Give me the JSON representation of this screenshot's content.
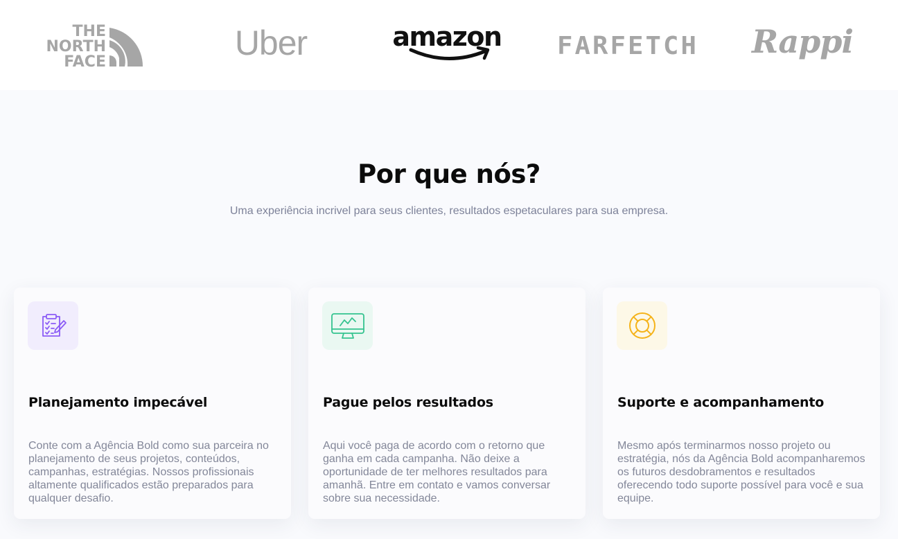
{
  "logos": [
    {
      "name": "The North Face",
      "lines": [
        "THE",
        "NORTH",
        "FACE"
      ],
      "color": "#a6a6a6"
    },
    {
      "name": "Uber",
      "text": "Uber",
      "color": "#a6a6a6"
    },
    {
      "name": "Amazon",
      "text": "amazon",
      "color": "#111111"
    },
    {
      "name": "Farfetch",
      "text": "FARFETCH",
      "color": "#a6a6a6"
    },
    {
      "name": "Rappi",
      "text": "Rappi",
      "color": "#a6a6a6"
    }
  ],
  "section": {
    "title": "Por que nós?",
    "subtitle": "Uma experiência incrivel para seus clientes, resultados espetaculares para sua empresa."
  },
  "cards": [
    {
      "icon": "clipboard-checklist-icon",
      "icon_color": "#8b5cf6",
      "icon_bg": "#f1edfd",
      "title": "Planejamento impecável",
      "text": "Conte com a Agência Bold como sua parceira no planejamento de seus projetos, conteúdos, campanhas, estratégias. Nossos profissionais altamente qualificados estão preparados para qualquer desafio."
    },
    {
      "icon": "monitor-chart-icon",
      "icon_color": "#34c38f",
      "icon_bg": "#eaf8f2",
      "title": "Pague pelos resultados",
      "text": "Aqui você paga de acordo com o retorno que ganha em cada campanha. Não deixe a oportunidade de ter melhores resultados para amanhã. Entre em contato e vamos conversar sobre sua necessidade."
    },
    {
      "icon": "lifebuoy-icon",
      "icon_color": "#f5b31a",
      "icon_bg": "#fdf8e7",
      "title": "Suporte e acompanhamento",
      "text": "Mesmo após terminarmos nosso projeto ou estratégia, nós da Agência Bold acompanharemos os futuros desdobramentos e resultados oferecendo todo suporte possível para você e sua equipe."
    }
  ]
}
